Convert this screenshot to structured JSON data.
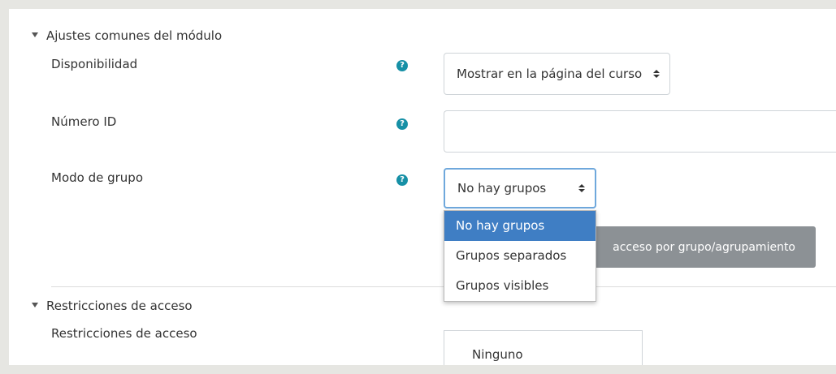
{
  "section_common": {
    "title": "Ajustes comunes del módulo"
  },
  "availability": {
    "label": "Disponibilidad",
    "value": "Mostrar en la página del curso"
  },
  "id_number": {
    "label": "Número ID",
    "value": ""
  },
  "group_mode": {
    "label": "Modo de grupo",
    "value": "No hay grupos",
    "options": [
      "No hay grupos",
      "Grupos separados",
      "Grupos visibles"
    ],
    "selected_index": 0
  },
  "group_button": {
    "label": "acceso por grupo/agrupamiento"
  },
  "section_access": {
    "title": "Restricciones de acceso"
  },
  "access_restrictions": {
    "label": "Restricciones de acceso",
    "value": "Ninguno"
  },
  "help_icon": {
    "glyph": "?"
  },
  "colors": {
    "accent": "#1690a6",
    "selected_option": "#3f7ec4",
    "button_grey": "#8c9195"
  }
}
